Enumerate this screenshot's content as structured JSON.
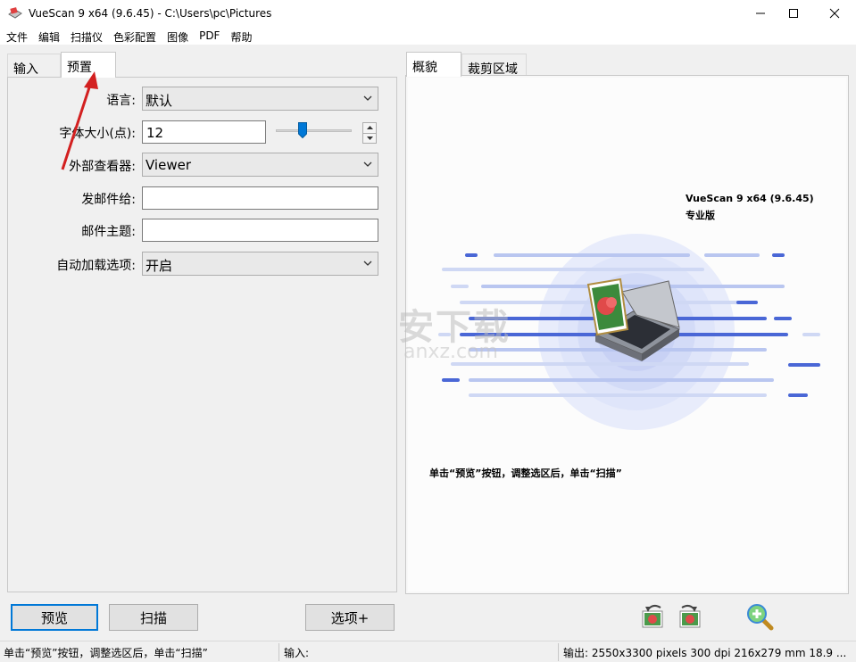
{
  "window": {
    "title": "VueScan 9 x64 (9.6.45) - C:\\Users\\pc\\Pictures"
  },
  "menu": [
    "文件",
    "编辑",
    "扫描仪",
    "色彩配置",
    "图像",
    "PDF",
    "帮助"
  ],
  "left_tabs": [
    {
      "label": "输入",
      "active": false
    },
    {
      "label": "预置",
      "active": true
    }
  ],
  "right_tabs": [
    {
      "label": "概貌",
      "active": true
    },
    {
      "label": "裁剪区域",
      "active": false
    }
  ],
  "prefs": {
    "language": {
      "label": "语言:",
      "value": "默认"
    },
    "font_size": {
      "label": "字体大小(点):",
      "value": "12",
      "slider_fraction": 0.35
    },
    "viewer": {
      "label": "外部查看器:",
      "value": "Viewer"
    },
    "mail_to": {
      "label": "发邮件给:",
      "value": ""
    },
    "mail_subject": {
      "label": "邮件主题:",
      "value": ""
    },
    "auto_load": {
      "label": "自动加载选项:",
      "value": "开启"
    }
  },
  "preview": {
    "version": "VueScan 9 x64 (9.6.45)",
    "edition": "专业版",
    "hint": "单击“预览”按钮，调整选区后，单击“扫描”",
    "watermark_text": "安下载",
    "watermark_sub": "anxz.com"
  },
  "buttons": {
    "preview": "预览",
    "scan": "扫描",
    "options": "选项+"
  },
  "status": {
    "left": "单击“预览”按钮，调整选区后，单击“扫描”",
    "input": "输入:",
    "output": "输出: 2550x3300 pixels 300 dpi 216x279 mm 18.9 ..."
  },
  "icons": {
    "app": "scanner-app-icon",
    "rotate_left": "rotate-left-icon",
    "rotate_right": "rotate-right-icon",
    "zoom_in": "zoom-in-icon"
  },
  "colors": {
    "accent": "#0078d7",
    "arrow_annotation": "#d32020",
    "stripe_blue": "#4a67d6"
  }
}
